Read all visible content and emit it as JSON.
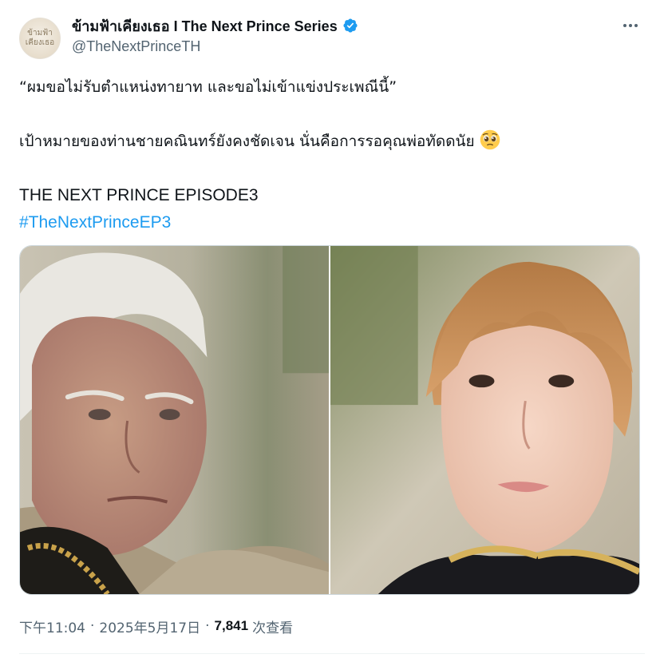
{
  "author": {
    "display_name": "ข้ามฟ้าเคียงเธอ I The Next Prince Series",
    "handle": "@TheNextPrinceTH",
    "verified": true,
    "avatar_text": "ข้ามฟ้า เคียงเธอ",
    "icons": {
      "verified": "verified-badge-icon",
      "more": "more-options-icon"
    }
  },
  "tweet": {
    "line1": "“ผมขอไม่รับตำแหน่งทายาท และขอไม่เข้าแข่งประเพณีนี้”",
    "line2": "เป้าหมายของท่านชายคณินทร์ยังคงชัดเจน นั่นคือการรอคุณพ่อทัดดนัย",
    "line2_emoji": "pleading-face-emoji",
    "line3": "THE NEXT PRINCE EPISODE3",
    "hashtag": "#TheNextPrinceEP3"
  },
  "media": {
    "images": [
      {
        "subject": "elderly-man-still"
      },
      {
        "subject": "young-man-still"
      }
    ]
  },
  "meta": {
    "time": "下午11:04",
    "sep1": "·",
    "date": "2025年5月17日",
    "sep2": "·",
    "views_count": "7,841",
    "views_label": "次查看"
  },
  "colors": {
    "text": "#0f1419",
    "secondary": "#536471",
    "link": "#1d9bf0",
    "verified": "#1d9bf0",
    "border": "#cfd9de"
  }
}
